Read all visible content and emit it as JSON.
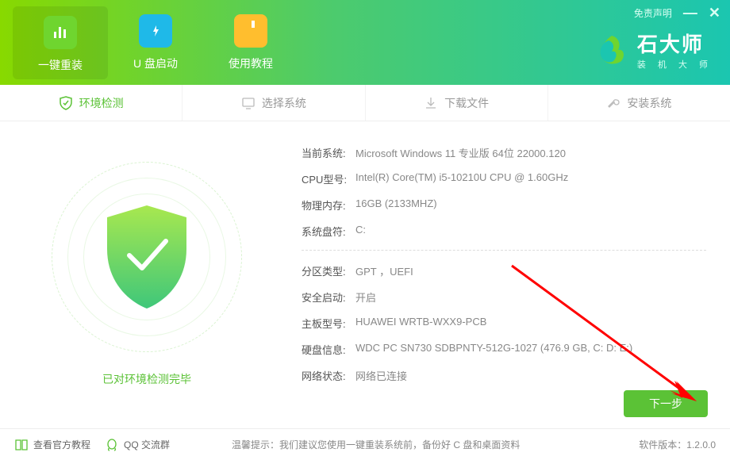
{
  "header": {
    "disclaimer": "免责声明",
    "nav": [
      {
        "label": "一键重装"
      },
      {
        "label": "U 盘启动"
      },
      {
        "label": "使用教程"
      }
    ],
    "brand_title": "石大师",
    "brand_sub": "装 机 大 师"
  },
  "tabs": [
    {
      "label": "环境检测"
    },
    {
      "label": "选择系统"
    },
    {
      "label": "下载文件"
    },
    {
      "label": "安装系统"
    }
  ],
  "status_text": "已对环境检测完毕",
  "info": {
    "os_label": "当前系统:",
    "os_value": "Microsoft Windows 11 专业版 64位 22000.120",
    "cpu_label": "CPU型号:",
    "cpu_value": "Intel(R) Core(TM) i5-10210U CPU @ 1.60GHz",
    "mem_label": "物理内存:",
    "mem_value": "16GB (2133MHZ)",
    "sysdrive_label": "系统盘符:",
    "sysdrive_value": "C:",
    "part_label": "分区类型:",
    "part_value": "GPT ，UEFI",
    "secure_label": "安全启动:",
    "secure_value": "开启",
    "board_label": "主板型号:",
    "board_value": "HUAWEI WRTB-WXX9-PCB",
    "disk_label": "硬盘信息:",
    "disk_value": "WDC PC SN730 SDBPNTY-512G-1027  (476.9 GB, C: D: E:)",
    "net_label": "网络状态:",
    "net_value": "网络已连接"
  },
  "next_button": "下一步",
  "footer": {
    "tutorial": "查看官方教程",
    "qq": "QQ 交流群",
    "tip_label": "温馨提示：",
    "tip_text": "我们建议您使用一键重装系统前，备份好 C 盘和桌面资料",
    "version_label": "软件版本：",
    "version": "1.2.0.0"
  }
}
